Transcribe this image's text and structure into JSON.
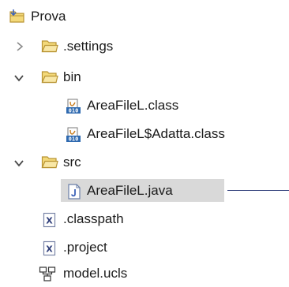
{
  "tree": {
    "root": {
      "label": "Prova",
      "icon": "project-folder-icon"
    },
    "items": [
      {
        "label": ".settings",
        "icon": "folder-icon",
        "twisty": "collapsed"
      },
      {
        "label": "bin",
        "icon": "folder-icon",
        "twisty": "expanded"
      },
      {
        "label": "AreaFileL.class",
        "icon": "class-file-icon"
      },
      {
        "label": "AreaFileL$Adatta.class",
        "icon": "class-file-icon"
      },
      {
        "label": "src",
        "icon": "folder-icon",
        "twisty": "expanded"
      },
      {
        "label": "AreaFileL.java",
        "icon": "java-file-icon",
        "selected": true
      },
      {
        "label": ".classpath",
        "icon": "xml-file-icon"
      },
      {
        "label": ".project",
        "icon": "xml-file-icon"
      },
      {
        "label": "model.ucls",
        "icon": "class-diagram-icon"
      }
    ]
  },
  "colors": {
    "folder": "#e8c75a",
    "folder_stroke": "#b99433",
    "selection": "#d9d9d9",
    "pointer": "#2f3e7a",
    "project_accent": "#3d63b8"
  }
}
